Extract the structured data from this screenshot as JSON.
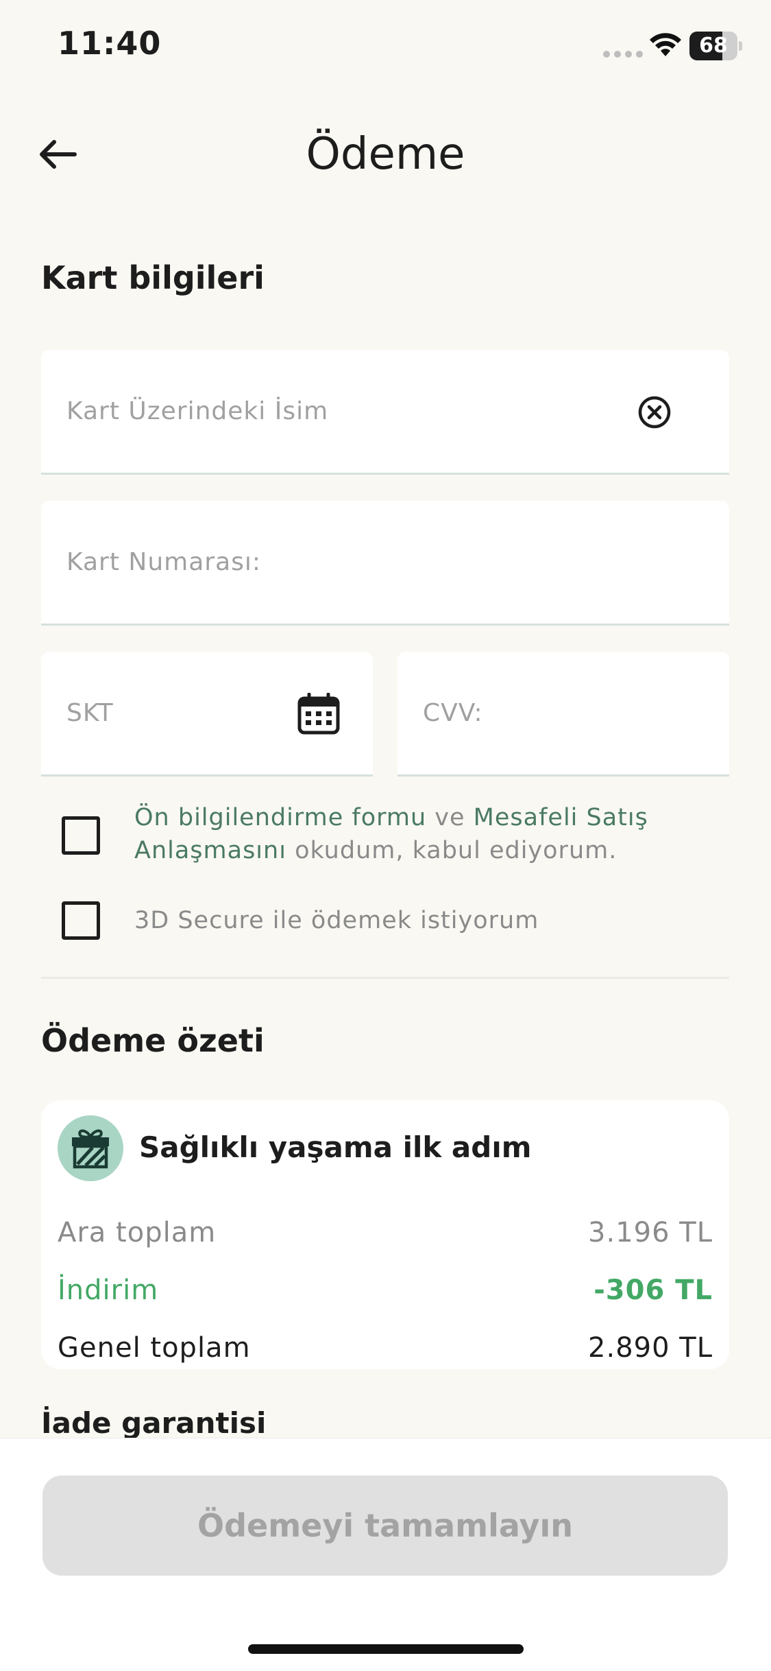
{
  "status_bar": {
    "time": "11:40",
    "battery": "68",
    "battery_level": 0.68
  },
  "header": {
    "title": "Ödeme",
    "back_icon": "arrow-left-icon"
  },
  "card_section": {
    "title": "Kart bilgileri",
    "name_placeholder": "Kart Üzerindeki İsim",
    "number_placeholder": "Kart Numarası:",
    "expiry_placeholder": "SKT",
    "cvv_placeholder": "CVV:",
    "clear_icon": "circle-x-icon",
    "calendar_icon": "calendar-icon"
  },
  "consent": {
    "link1": "Ön bilgilendirme formu",
    "connector": " ve ",
    "link2": "Mesafeli Satış Anlaşmasını",
    "suffix": " okudum, kabul ediyorum.",
    "secure3d": "3D Secure ile ödemek istiyorum"
  },
  "summary": {
    "title": "Ödeme özeti",
    "plan_name": "Sağlıklı yaşama ilk adım",
    "gift_icon": "gift-icon",
    "subtotal_label": "Ara toplam",
    "subtotal_value": "3.196 TL",
    "discount_label": "İndirim",
    "discount_value": "-306 TL",
    "total_label": "Genel toplam",
    "total_value": "2.890 TL"
  },
  "refund": {
    "title": "İade garantisi"
  },
  "footer": {
    "pay_label": "Ödemeyi tamamlayın"
  },
  "colors": {
    "background": "#f9f8f2",
    "link": "#4a7a62",
    "discount": "#43a865",
    "gift_badge": "#a9d5c4",
    "button_disabled": "#e0e0e0"
  }
}
